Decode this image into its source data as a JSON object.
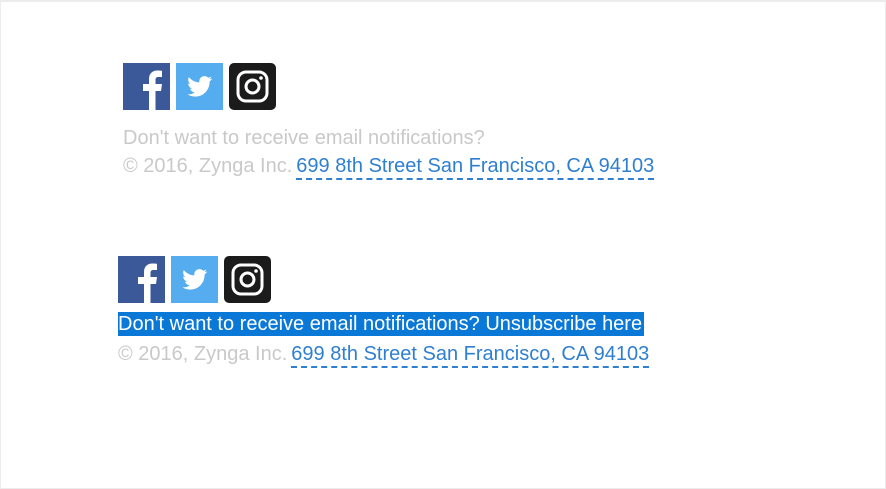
{
  "footers": [
    {
      "social": [
        {
          "icon": "facebook-icon",
          "color": "#3b5998"
        },
        {
          "icon": "twitter-icon",
          "color": "#55acee"
        },
        {
          "icon": "instagram-icon",
          "color": "#1b1b1b"
        }
      ],
      "unsubscribe_prompt": "Don't want to receive email notifications?",
      "unsubscribe_link": "",
      "copyright": "© 2016, Zynga Inc.",
      "address": "699 8th Street San Francisco, CA 94103"
    },
    {
      "social": [
        {
          "icon": "facebook-icon",
          "color": "#3b5998"
        },
        {
          "icon": "twitter-icon",
          "color": "#55acee"
        },
        {
          "icon": "instagram-icon",
          "color": "#1b1b1b"
        }
      ],
      "unsubscribe_prompt": "Don't want to receive email notifications?",
      "unsubscribe_link": "Unsubscribe here",
      "copyright": "© 2016, Zynga Inc.",
      "address": "699 8th Street San Francisco, CA 94103",
      "selection_color": "#0a78d7"
    }
  ]
}
